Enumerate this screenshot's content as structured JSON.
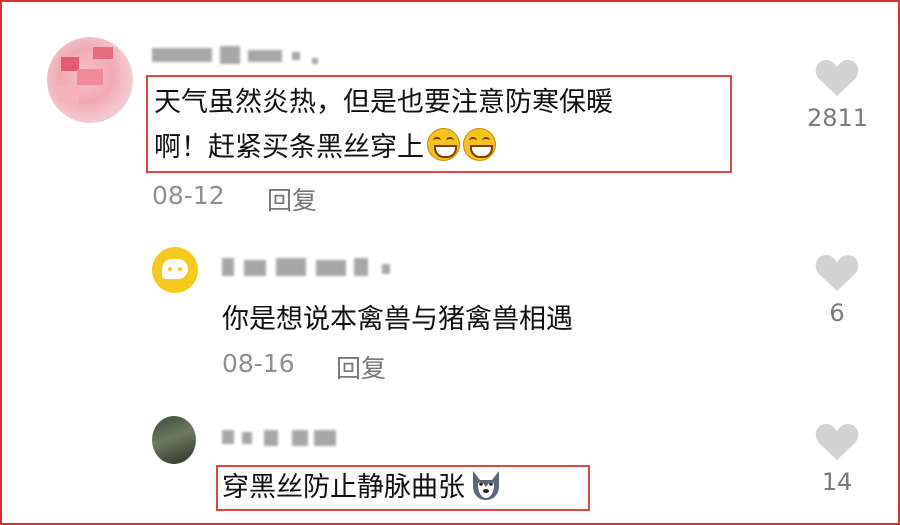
{
  "comments": [
    {
      "text_line1": "天气虽然炎热，但是也要注意防寒保暖",
      "text_line2": "啊！赶紧买条黑丝穿上",
      "emojis": [
        "grinning-face-icon",
        "grinning-face-icon"
      ],
      "date": "08-12",
      "reply_label": "回复",
      "like_count": "2811",
      "highlight_color": "#e2463e"
    },
    {
      "text": "你是想说本禽兽与猪禽兽相遇",
      "date": "08-16",
      "reply_label": "回复",
      "like_count": "6"
    },
    {
      "text": "穿黑丝防止静脉曲张",
      "emojis": [
        "husky-dog-icon"
      ],
      "like_count": "14",
      "highlight_color": "#e2463e"
    }
  ],
  "colors": {
    "frame": "#d9302b",
    "text": "#111111",
    "meta": "#8f8f8f",
    "like_icon": "#d2d2d2"
  }
}
